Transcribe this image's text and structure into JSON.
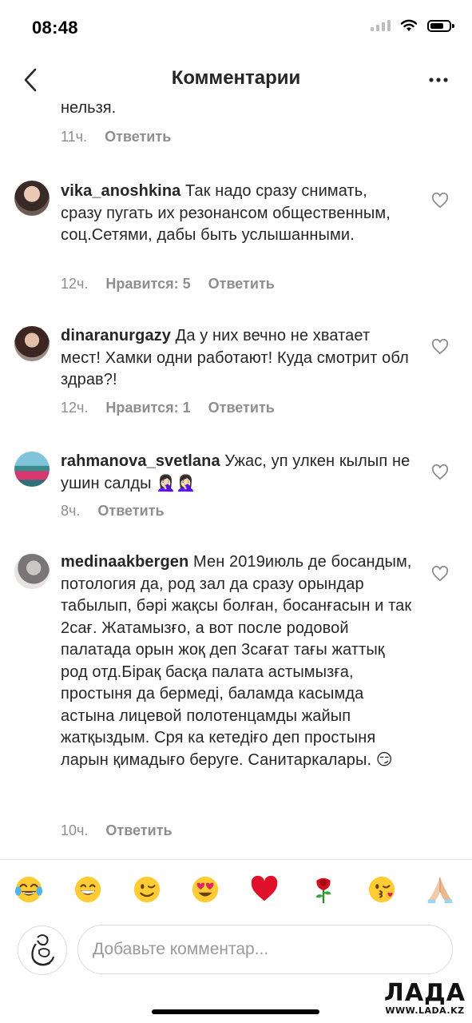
{
  "status_bar": {
    "time": "08:48"
  },
  "header": {
    "title": "Комментарии"
  },
  "partial_comment": {
    "text_tail": "нельзя.",
    "time": "11ч.",
    "reply_label": "Ответить"
  },
  "comments": [
    {
      "username": "vika_anoshkina",
      "text": "Так надо сразу снимать, сразу пугать их резонансом общественным, соц.Сетями, дабы быть услышанными.",
      "time": "12ч.",
      "likes_label": "Нравится: 5",
      "reply_label": "Ответить"
    },
    {
      "username": "dinaranurgazy",
      "text": "Да у них вечно не хватает мест! Хамки одни работают! Куда смотрит обл здрав?!",
      "time": "12ч.",
      "likes_label": "Нравится: 1",
      "reply_label": "Ответить"
    },
    {
      "username": "rahmanova_svetlana",
      "text": "Ужас, уп улкен кылып не ушин салды 🤦🏻‍♀️🤦🏻‍♀️",
      "time": "8ч.",
      "reply_label": "Ответить"
    },
    {
      "username": "medinaakbergen",
      "text": "Мен 2019июль де босандым, потология да, род зал да сразу орындар табылып, бәрі жақсы болған, босанғасын и так 2сағ. Жатамызғо, а вот после родовой палатада орын жоқ деп 3сағат тағы жаттық род отд.Бірақ басқа палата астымызға, простыня да бермеді, баламда касымда астына лицевой полотенцамды жайып жатқыздым. Сря ка кетедіғо деп простыня ларын қимадығо беруге. Санитаркалары. 😏",
      "time": "10ч.",
      "reply_label": "Ответить"
    }
  ],
  "emoji_bar": [
    "😂",
    "😁",
    "😉",
    "😍",
    "❤️",
    "🌹",
    "😘",
    "🙏🏻"
  ],
  "composer": {
    "placeholder": "Добавьте комментар..."
  },
  "watermark": {
    "logo": "ЛАДА",
    "url": "WWW.LADA.KZ"
  }
}
